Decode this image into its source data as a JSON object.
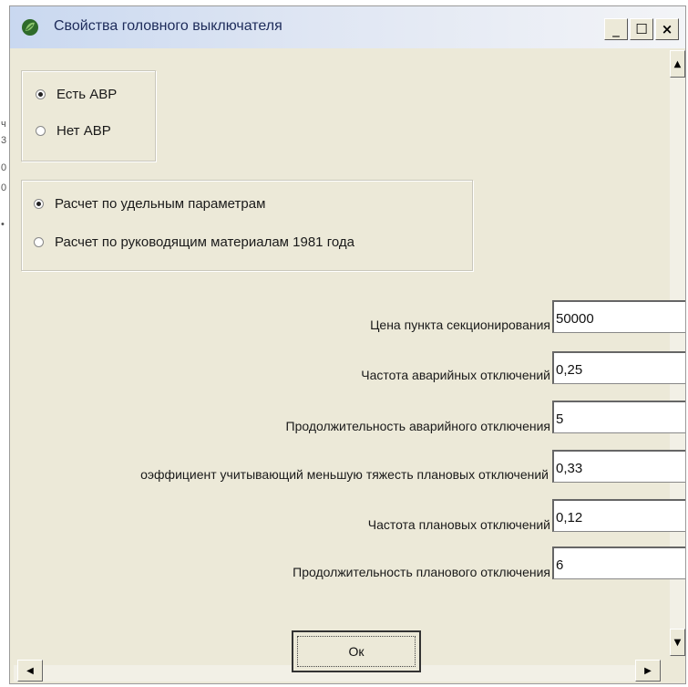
{
  "window": {
    "title": "Свойства головного выключателя",
    "buttons": {
      "minimize": "_",
      "maximize": "☐",
      "close": "×"
    }
  },
  "left_strip_marks": [
    "ч",
    "3",
    "0",
    "0",
    "•"
  ],
  "abr_group": {
    "options": [
      {
        "label": "Есть АВР",
        "checked": true
      },
      {
        "label": "Нет АВР",
        "checked": false
      }
    ]
  },
  "calc_group": {
    "options": [
      {
        "label": "Расчет по удельным параметрам",
        "checked": true
      },
      {
        "label": "Расчет по руководящим материалам 1981 года",
        "checked": false
      }
    ]
  },
  "params": [
    {
      "label": "Цена пункта секционирования",
      "value": "50000"
    },
    {
      "label": "Частота аварийных отключений",
      "value": "0,25"
    },
    {
      "label": "Продолжительность аварийного отключения",
      "value": "5"
    },
    {
      "label": "оэффициент учитывающий меньшую тяжесть плановых отключений",
      "value": "0,33"
    },
    {
      "label": "Частота плановых отключений",
      "value": "0,12"
    },
    {
      "label": "Продолжительность планового отключения",
      "value": "6"
    }
  ],
  "ok_button": "Ок",
  "icons": {
    "app": "leaf-icon",
    "scroll_up": "▲",
    "scroll_down": "▼",
    "scroll_left": "◀",
    "scroll_right": "▶"
  }
}
